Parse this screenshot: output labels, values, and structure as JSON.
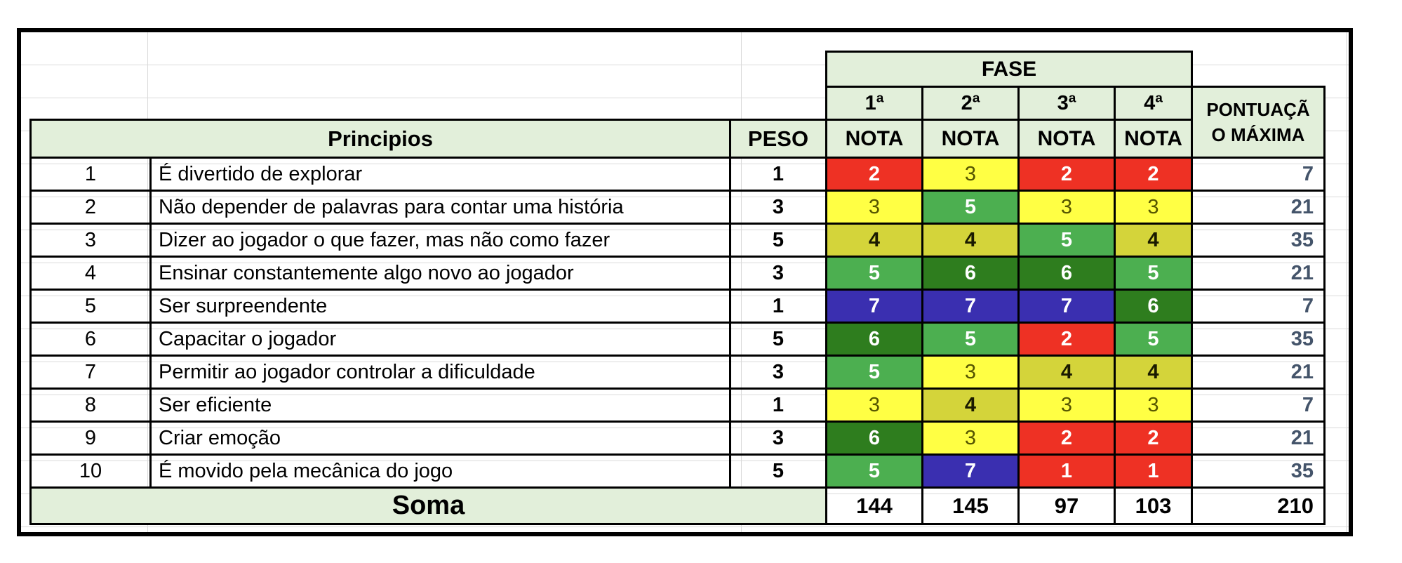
{
  "header": {
    "fase": "FASE",
    "phases": [
      "1ª",
      "2ª",
      "3ª",
      "4ª"
    ],
    "nota": "NOTA",
    "principios": "Principios",
    "peso": "PESO",
    "max_line1": "PONTUAÇÃ",
    "max_line2": "O MÁXIMA"
  },
  "rows": [
    {
      "n": "1",
      "principio": " É divertido de explorar",
      "peso": "1",
      "notas": [
        "2",
        "3",
        "2",
        "2"
      ],
      "max": "7"
    },
    {
      "n": "2",
      "principio": " Não depender de palavras para contar uma história",
      "peso": "3",
      "notas": [
        "3",
        "5",
        "3",
        "3"
      ],
      "max": "21"
    },
    {
      "n": "3",
      "principio": "Dizer ao jogador o que fazer, mas não como fazer",
      "peso": "5",
      "notas": [
        "4",
        "4",
        "5",
        "4"
      ],
      "max": "35"
    },
    {
      "n": "4",
      "principio": "Ensinar constantemente algo novo ao jogador",
      "peso": "3",
      "notas": [
        "5",
        "6",
        "6",
        "5"
      ],
      "max": "21"
    },
    {
      "n": "5",
      "principio": "Ser surpreendente",
      "peso": "1",
      "notas": [
        "7",
        "7",
        "7",
        "6"
      ],
      "max": "7"
    },
    {
      "n": "6",
      "principio": "Capacitar o jogador",
      "peso": "5",
      "notas": [
        "6",
        "5",
        "2",
        "5"
      ],
      "max": "35"
    },
    {
      "n": "7",
      "principio": "Permitir ao jogador controlar a dificuldade",
      "peso": "3",
      "notas": [
        "5",
        "3",
        "4",
        "4"
      ],
      "max": "21"
    },
    {
      "n": "8",
      "principio": "Ser eficiente",
      "peso": "1",
      "notas": [
        "3",
        "4",
        "3",
        "3"
      ],
      "max": "7"
    },
    {
      "n": "9",
      "principio": "Criar emoção",
      "peso": "3",
      "notas": [
        "6",
        "3",
        "2",
        "2"
      ],
      "max": "21"
    },
    {
      "n": "10",
      "principio": "É movido pela mecânica do jogo",
      "peso": "5",
      "notas": [
        "5",
        "7",
        "1",
        "1"
      ],
      "max": "35"
    }
  ],
  "soma": {
    "label": "Soma",
    "totals": [
      "144",
      "145",
      "97",
      "103"
    ],
    "max": "210"
  },
  "score_colors": {
    "1": "#ee3124",
    "2": "#ee3124",
    "3": "#ffff44",
    "4": "#d4d43a",
    "5": "#4caf50",
    "6": "#2e7d1e",
    "7": "#3a2fb0"
  }
}
